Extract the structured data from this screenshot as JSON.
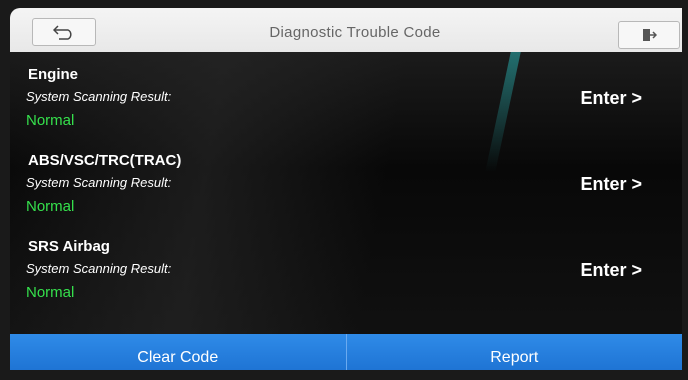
{
  "header": {
    "title": "Diagnostic Trouble Code"
  },
  "systems": [
    {
      "name": "Engine",
      "result_label": "System Scanning Result:",
      "status": "Normal",
      "action": "Enter >"
    },
    {
      "name": "ABS/VSC/TRC(TRAC)",
      "result_label": "System Scanning Result:",
      "status": "Normal",
      "action": "Enter >"
    },
    {
      "name": "SRS Airbag",
      "result_label": "System Scanning Result:",
      "status": "Normal",
      "action": "Enter >"
    }
  ],
  "footer": {
    "clear_label": "Clear Code",
    "report_label": "Report"
  },
  "colors": {
    "status_ok": "#35e04c",
    "button_blue": "#2f8be8"
  }
}
